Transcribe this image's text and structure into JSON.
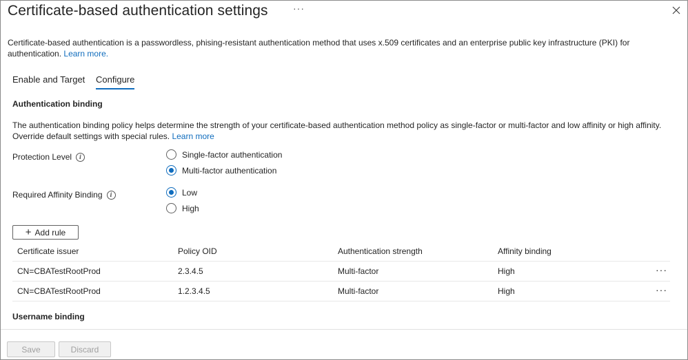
{
  "header": {
    "title": "Certificate-based authentication settings",
    "more_label": "···"
  },
  "intro": {
    "text": "Certificate-based authentication is a passwordless, phising-resistant authentication method that uses x.509 certificates and an enterprise public key infrastructure (PKI) for authentication. ",
    "link": "Learn more."
  },
  "tabs": [
    {
      "label": "Enable and Target",
      "active": false
    },
    {
      "label": "Configure",
      "active": true
    }
  ],
  "auth_binding": {
    "title": "Authentication binding",
    "description": "The authentication binding policy helps determine the strength of your certificate-based authentication method policy as single-factor or multi-factor and low affinity or high affinity. Override default settings with special rules. ",
    "link": "Learn more"
  },
  "protection_level": {
    "label": "Protection Level",
    "options": [
      {
        "label": "Single-factor authentication",
        "checked": false
      },
      {
        "label": "Multi-factor authentication",
        "checked": true
      }
    ]
  },
  "affinity_binding": {
    "label": "Required Affinity Binding",
    "options": [
      {
        "label": "Low",
        "checked": true
      },
      {
        "label": "High",
        "checked": false
      }
    ]
  },
  "add_rule": {
    "label": "Add rule"
  },
  "rules_table": {
    "columns": [
      "Certificate issuer",
      "Policy OID",
      "Authentication strength",
      "Affinity binding"
    ],
    "rows": [
      {
        "issuer": "CN=CBATestRootProd",
        "oid": "2.3.4.5",
        "strength": "Multi-factor",
        "affinity": "High"
      },
      {
        "issuer": "CN=CBATestRootProd",
        "oid": "1.2.3.4.5",
        "strength": "Multi-factor",
        "affinity": "High"
      }
    ],
    "row_more": "···"
  },
  "username_binding": {
    "title": "Username binding"
  },
  "footer": {
    "save_label": "Save",
    "discard_label": "Discard"
  },
  "colors": {
    "accent": "#0f6cbd",
    "disabled_text": "#a0a0a0"
  }
}
